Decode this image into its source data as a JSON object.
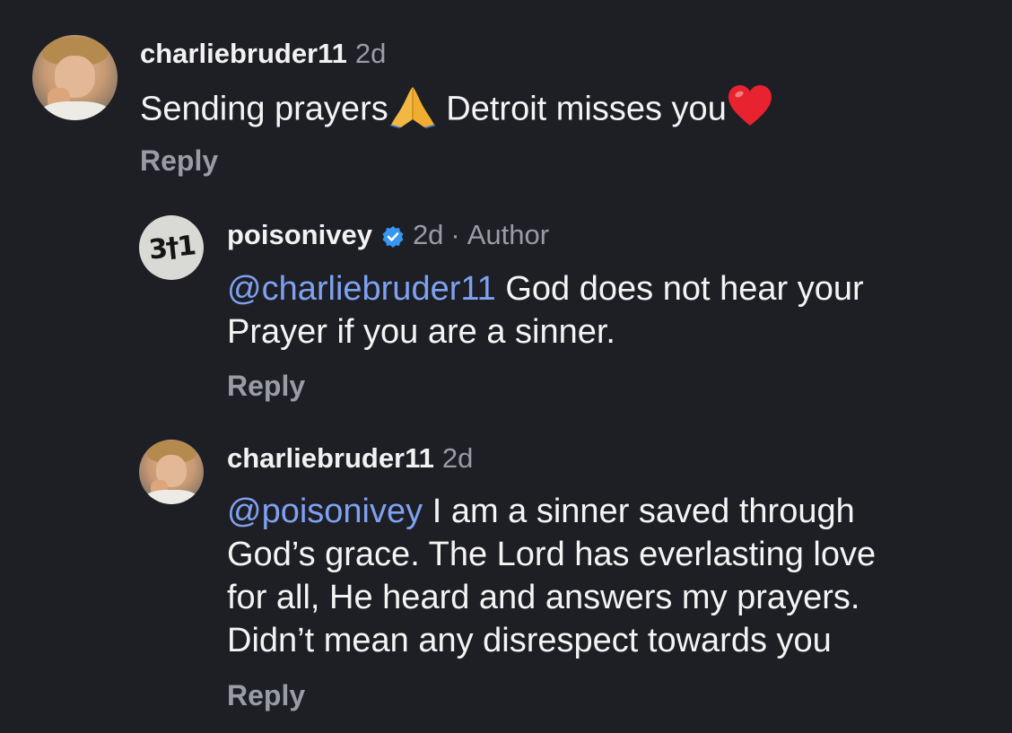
{
  "comments": [
    {
      "username": "charliebruder11",
      "time": "2d",
      "text_parts": [
        "Sending prayers",
        " Detroit misses you"
      ],
      "emojis": [
        "folded-hands",
        "red-heart"
      ],
      "reply_label": "Reply"
    },
    {
      "username": "poisonivey",
      "verified": true,
      "time": "2d",
      "separator": "·",
      "author_label": "Author",
      "mention": "@charliebruder11",
      "lines": [
        " God does not hear your",
        "Prayer if you are a sinner."
      ],
      "reply_label": "Reply",
      "avatar_text": "3†1"
    },
    {
      "username": "charliebruder11",
      "time": "2d",
      "mention": "@poisonivey",
      "lines": [
        " I am a sinner saved through",
        "God’s grace. The Lord has everlasting love",
        "for all, He heard and answers my prayers.",
        "Didn’t mean any disrespect towards you"
      ],
      "reply_label": "Reply"
    }
  ],
  "colors": {
    "background": "#1e1f24",
    "text": "#f4f4f4",
    "muted": "#9a9ca3",
    "mention": "#7ea1f2",
    "verified": "#3797f0"
  }
}
